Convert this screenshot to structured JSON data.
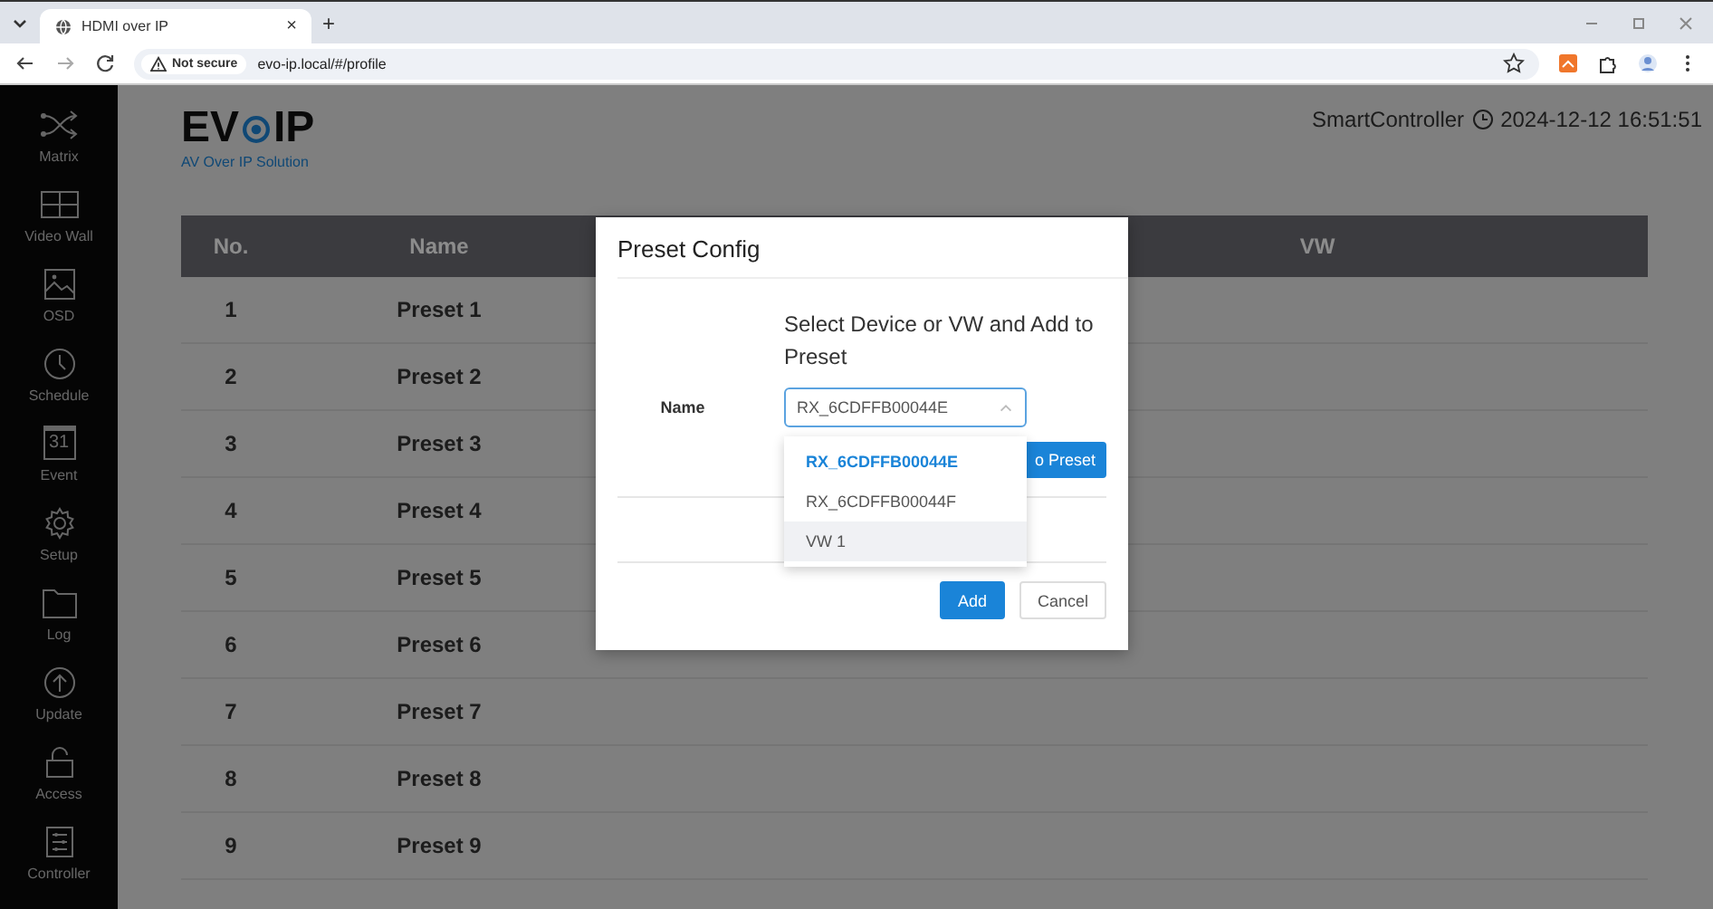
{
  "browser": {
    "tab_title": "HDMI over IP",
    "new_tab": "+",
    "close_tab": "×",
    "security": "Not secure",
    "url": "evo-ip.local/#/profile"
  },
  "sidebar": {
    "items": [
      {
        "kind": "matrix",
        "label": "Matrix"
      },
      {
        "kind": "videowall",
        "label": "Video Wall"
      },
      {
        "kind": "osd",
        "label": "OSD"
      },
      {
        "kind": "schedule",
        "label": "Schedule"
      },
      {
        "kind": "event",
        "label": "Event",
        "icon_text": "31"
      },
      {
        "kind": "setup",
        "label": "Setup"
      },
      {
        "kind": "log",
        "label": "Log"
      },
      {
        "kind": "update",
        "label": "Update"
      },
      {
        "kind": "access",
        "label": "Access"
      },
      {
        "kind": "controller",
        "label": "Controller"
      }
    ]
  },
  "logo": {
    "left": "EV",
    "right": "IP",
    "tagline": "AV Over IP Solution"
  },
  "header": {
    "device": "SmartController",
    "datetime": "2024-12-12 16:51:51"
  },
  "table": {
    "columns": [
      "No.",
      "Name",
      "VW"
    ],
    "rows": [
      {
        "no": "1",
        "name": "Preset 1"
      },
      {
        "no": "2",
        "name": "Preset 2"
      },
      {
        "no": "3",
        "name": "Preset 3"
      },
      {
        "no": "4",
        "name": "Preset 4"
      },
      {
        "no": "5",
        "name": "Preset 5"
      },
      {
        "no": "6",
        "name": "Preset 6"
      },
      {
        "no": "7",
        "name": "Preset 7"
      },
      {
        "no": "8",
        "name": "Preset 8"
      },
      {
        "no": "9",
        "name": "Preset 9"
      }
    ]
  },
  "modal": {
    "title": "Preset Config",
    "prompt": "Select Device or VW and Add to Preset",
    "name_label": "Name",
    "select_value": "RX_6CDFFB00044E",
    "add_to_preset_visible": "o Preset",
    "buttons": [
      {
        "kind": "primary",
        "label": "Add"
      },
      {
        "kind": "default",
        "label": "Cancel"
      }
    ],
    "dropdown": [
      {
        "label": "RX_6CDFFB00044E",
        "selected": true,
        "hovered": false
      },
      {
        "label": "RX_6CDFFB00044F",
        "selected": false,
        "hovered": false
      },
      {
        "label": "VW 1",
        "selected": false,
        "hovered": true
      }
    ]
  }
}
